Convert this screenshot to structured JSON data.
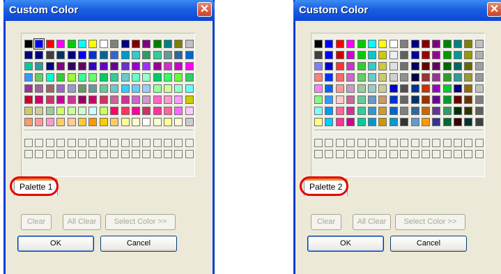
{
  "dialogs": [
    {
      "title": "Custom Color",
      "tab_label": "Palette 1",
      "buttons": {
        "clear": "Clear",
        "all_clear": "All Clear",
        "select_color": "Select Color >>",
        "ok": "OK",
        "cancel": "Cancel"
      },
      "selected_index": 1,
      "palette": [
        "#000000",
        "#0000ff",
        "#ff0000",
        "#ff00ff",
        "#00cc00",
        "#00ffff",
        "#ffff00",
        "#ffffff",
        "#808080",
        "#000080",
        "#800000",
        "#800080",
        "#008000",
        "#008080",
        "#808000",
        "#c0c0c0",
        "#000080",
        "#000080",
        "#3f3f3f",
        "#003366",
        "#000080",
        "#0000ff",
        "#0033cc",
        "#006699",
        "#3366cc",
        "#0099cc",
        "#33cccc",
        "#339966",
        "#33cc99",
        "#669999",
        "#336699",
        "#0066cc",
        "#00cc99",
        "#339999",
        "#000080",
        "#800080",
        "#330066",
        "#660066",
        "#3300cc",
        "#6600cc",
        "#660099",
        "#6633cc",
        "#9900cc",
        "#9933ff",
        "#990099",
        "#cc33cc",
        "#cc00cc",
        "#ff00ff",
        "#3399ff",
        "#66cc66",
        "#00ffcc",
        "#33cc33",
        "#99ff33",
        "#33ff99",
        "#66ff66",
        "#00cc66",
        "#33cc99",
        "#66cccc",
        "#66ffcc",
        "#99ffcc",
        "#00cc66",
        "#33ff66",
        "#66ff33",
        "#33cc66",
        "#993399",
        "#996699",
        "#996666",
        "#9966cc",
        "#9999cc",
        "#669966",
        "#669999",
        "#66cc99",
        "#66cccc",
        "#33ccff",
        "#66ccff",
        "#99ccff",
        "#99ff99",
        "#ccff99",
        "#99ffcc",
        "#66ffff",
        "#cc0033",
        "#cc0066",
        "#cc3366",
        "#cc0099",
        "#cc3399",
        "#990066",
        "#cc0066",
        "#cc3366",
        "#cc6699",
        "#cc3399",
        "#cc66cc",
        "#cc99cc",
        "#ff66cc",
        "#ff99cc",
        "#ff99ff",
        "#cccc00",
        "#cccc66",
        "#cccc99",
        "#99cc99",
        "#ccff66",
        "#ccff99",
        "#ccffcc",
        "#ccffff",
        "#ccff66",
        "#ff0066",
        "#ff3366",
        "#ff0099",
        "#cc3366",
        "#ff3399",
        "#ff6699",
        "#ff66ff",
        "#ffccff",
        "#ff9966",
        "#ff9999",
        "#ff99cc",
        "#ffcc66",
        "#ffcc99",
        "#ffcc33",
        "#ff9900",
        "#ffcc00",
        "#ffcc66",
        "#ffff99",
        "#ffffcc",
        "#ffffff",
        "#ffffcc",
        "#ffff99",
        "#ffffcc",
        "#cccccc"
      ]
    },
    {
      "title": "Custom Color",
      "tab_label": "Palette 2",
      "buttons": {
        "clear": "Clear",
        "all_clear": "All Clear",
        "select_color": "Select Color >>",
        "ok": "OK",
        "cancel": "Cancel"
      },
      "selected_index": -1,
      "palette": [
        "#000000",
        "#0000ff",
        "#ff0000",
        "#ff00ff",
        "#00cc00",
        "#00ffff",
        "#ffff00",
        "#ffffff",
        "#808080",
        "#000080",
        "#800000",
        "#800080",
        "#008000",
        "#008080",
        "#808000",
        "#c0c0c0",
        "#404040",
        "#0000ff",
        "#cc0000",
        "#cc00cc",
        "#00cc00",
        "#00cccc",
        "#cccc00",
        "#f0f0f0",
        "#606060",
        "#000099",
        "#990000",
        "#990099",
        "#009900",
        "#009999",
        "#999900",
        "#b0b0b0",
        "#8080ff",
        "#0000cc",
        "#ff3333",
        "#cc33cc",
        "#33cc33",
        "#33cccc",
        "#cccc33",
        "#e0e0e0",
        "#707070",
        "#000066",
        "#660000",
        "#660066",
        "#006600",
        "#006666",
        "#666600",
        "#a0a0a0",
        "#ff8080",
        "#0033ff",
        "#ff6666",
        "#cc66cc",
        "#66cc66",
        "#66cccc",
        "#cccc66",
        "#d0d0d0",
        "#909090",
        "#000044",
        "#993333",
        "#993399",
        "#339933",
        "#339999",
        "#999933",
        "#999999",
        "#ff80ff",
        "#0066ff",
        "#ff9999",
        "#cc99cc",
        "#99cc99",
        "#99cccc",
        "#cccc99",
        "#0000cc",
        "#505050",
        "#003399",
        "#cc3300",
        "#9900cc",
        "#00cc33",
        "#000080",
        "#996600",
        "#c0c0c0",
        "#80ff80",
        "#3399ff",
        "#ffcccc",
        "#cc6699",
        "#66cc99",
        "#6699cc",
        "#cc9966",
        "#0033cc",
        "#666666",
        "#003366",
        "#993300",
        "#660099",
        "#009933",
        "#660000",
        "#663300",
        "#808080",
        "#80ffff",
        "#0099ff",
        "#ff6699",
        "#cc3399",
        "#33cc99",
        "#3399cc",
        "#cc9933",
        "#0066cc",
        "#808080",
        "#336699",
        "#cc6600",
        "#663399",
        "#339966",
        "#003300",
        "#333300",
        "#606060",
        "#ffff80",
        "#00ccff",
        "#ff3399",
        "#cc0099",
        "#00cc99",
        "#0099cc",
        "#cc9900",
        "#0099cc",
        "#333333",
        "#6699cc",
        "#ff9900",
        "#333399",
        "#006633",
        "#330000",
        "#003333",
        "#404040"
      ]
    }
  ]
}
